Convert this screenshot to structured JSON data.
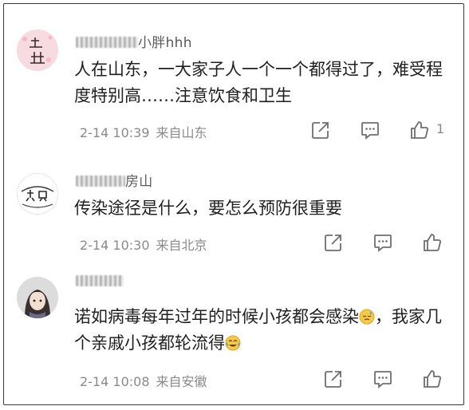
{
  "comments": [
    {
      "username_visible": "小胖hhh",
      "text": "人在山东，一大家子人一个一个都得过了，难受程度特别高……注意饮食和卫生",
      "time": "2-14 10:39",
      "location": "来自山东",
      "likes": "1",
      "avatar_text": "一生"
    },
    {
      "username_visible": "房山",
      "text": "传染途径是什么，要怎么预防很重要",
      "time": "2-14 10:30",
      "location": "来自北京",
      "likes": "",
      "avatar_text": "初见"
    },
    {
      "username_visible": "",
      "text_before_emoji": "诺如病毒每年过年的时候小孩都会感染",
      "text_after_emoji1": "，我家几个亲戚小孩都轮流得",
      "time": "2-14 10:08",
      "location": "来自安徽",
      "likes": "",
      "emoji_1": "sleepy-sweat-emoji",
      "emoji_2": "crying-laugh-emoji"
    }
  ],
  "colors": {
    "text": "#1f1f1f",
    "meta": "#8a8a8a",
    "icon": "#6e6e6e",
    "border": "#3a3a3a"
  },
  "icons": {
    "share": "share-icon",
    "comment": "comment-icon",
    "like": "thumbs-up-icon"
  }
}
